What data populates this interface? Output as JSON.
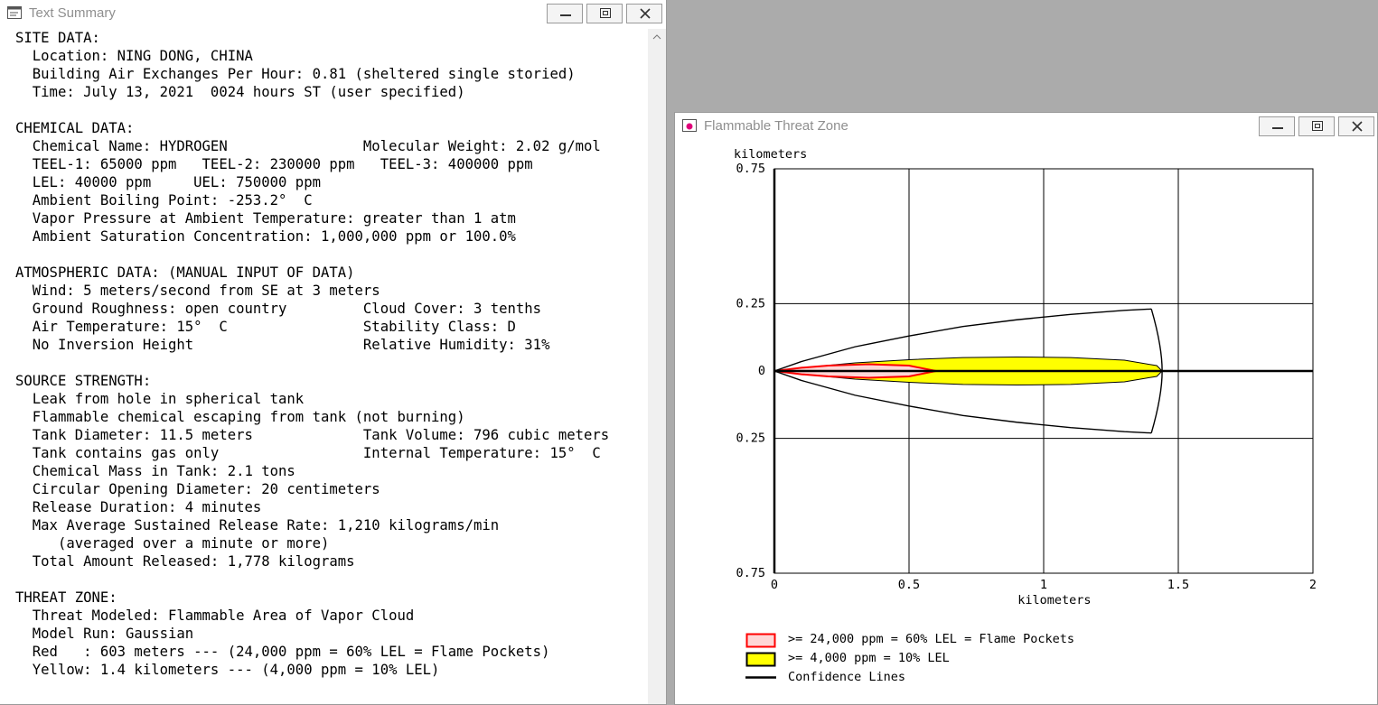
{
  "summary_window": {
    "title": "Text Summary",
    "lines": [
      "SITE DATA:",
      "  Location: NING DONG, CHINA",
      "  Building Air Exchanges Per Hour: 0.81 (sheltered single storied)",
      "  Time: July 13, 2021  0024 hours ST (user specified)",
      "",
      "CHEMICAL DATA:",
      "  Chemical Name: HYDROGEN                Molecular Weight: 2.02 g/mol",
      "  TEEL-1: 65000 ppm   TEEL-2: 230000 ppm   TEEL-3: 400000 ppm",
      "  LEL: 40000 ppm     UEL: 750000 ppm",
      "  Ambient Boiling Point: -253.2°  C",
      "  Vapor Pressure at Ambient Temperature: greater than 1 atm",
      "  Ambient Saturation Concentration: 1,000,000 ppm or 100.0%",
      "",
      "ATMOSPHERIC DATA: (MANUAL INPUT OF DATA)",
      "  Wind: 5 meters/second from SE at 3 meters",
      "  Ground Roughness: open country         Cloud Cover: 3 tenths",
      "  Air Temperature: 15°  C                Stability Class: D",
      "  No Inversion Height                    Relative Humidity: 31%",
      "",
      "SOURCE STRENGTH:",
      "  Leak from hole in spherical tank",
      "  Flammable chemical escaping from tank (not burning)",
      "  Tank Diameter: 11.5 meters             Tank Volume: 796 cubic meters",
      "  Tank contains gas only                 Internal Temperature: 15°  C",
      "  Chemical Mass in Tank: 2.1 tons",
      "  Circular Opening Diameter: 20 centimeters",
      "  Release Duration: 4 minutes",
      "  Max Average Sustained Release Rate: 1,210 kilograms/min",
      "     (averaged over a minute or more)",
      "  Total Amount Released: 1,778 kilograms",
      "",
      "THREAT ZONE:",
      "  Threat Modeled: Flammable Area of Vapor Cloud",
      "  Model Run: Gaussian",
      "  Red   : 603 meters --- (24,000 ppm = 60% LEL = Flame Pockets)",
      "  Yellow: 1.4 kilometers --- (4,000 ppm = 10% LEL)"
    ]
  },
  "threat_window": {
    "title": "Flammable Threat Zone",
    "legend": [
      {
        "label": ">= 24,000 ppm = 60% LEL = Flame Pockets",
        "color": "#ff0000",
        "fill": "#ffc8c8"
      },
      {
        "label": ">= 4,000 ppm = 10% LEL",
        "color": "#000000",
        "fill": "#ffff00"
      },
      {
        "label": "Confidence Lines",
        "color": "#000000"
      }
    ]
  },
  "chart_data": {
    "type": "area",
    "xlabel": "kilometers",
    "ylabel": "kilometers",
    "x_ticks": [
      "0",
      "0.5",
      "1",
      "1.5",
      "2"
    ],
    "y_ticks": [
      "0.75",
      "0.25",
      "0",
      "0.25",
      "0.75"
    ],
    "xlim": [
      0,
      2
    ],
    "ylim": [
      -0.75,
      0.75
    ],
    "grid": true,
    "zones": [
      {
        "name": ">= 4,000 ppm = 10% LEL",
        "color": "#ffff00",
        "x": [
          0,
          0.1,
          0.3,
          0.5,
          0.7,
          0.9,
          1.1,
          1.3,
          1.42,
          1.44
        ],
        "half_width": [
          0,
          0.012,
          0.03,
          0.042,
          0.05,
          0.052,
          0.05,
          0.04,
          0.02,
          0
        ]
      },
      {
        "name": ">= 24,000 ppm = 60% LEL = Flame Pockets",
        "color": "#ff0000",
        "x": [
          0,
          0.1,
          0.2,
          0.35,
          0.5,
          0.6
        ],
        "half_width": [
          0,
          0.012,
          0.02,
          0.025,
          0.02,
          0
        ]
      }
    ],
    "confidence_lines": {
      "x": [
        0,
        0.1,
        0.3,
        0.5,
        0.7,
        0.9,
        1.1,
        1.3,
        1.4
      ],
      "half_width": [
        0,
        0.035,
        0.09,
        0.13,
        0.165,
        0.19,
        0.21,
        0.225,
        0.23
      ],
      "close_x": 1.44
    }
  }
}
